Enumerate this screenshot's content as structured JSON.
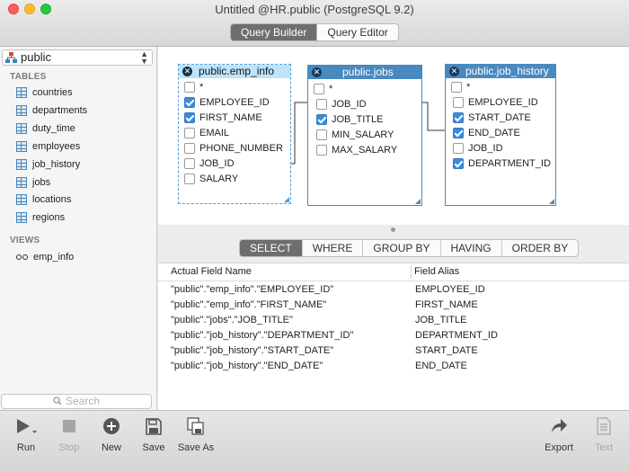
{
  "window": {
    "title": "Untitled @HR.public (PostgreSQL 9.2)",
    "modes": [
      "Query Builder",
      "Query Editor"
    ],
    "active_mode": "Query Builder"
  },
  "sidebar": {
    "schema": "public",
    "tables_header": "TABLES",
    "tables": [
      "countries",
      "departments",
      "duty_time",
      "employees",
      "job_history",
      "jobs",
      "locations",
      "regions"
    ],
    "views_header": "VIEWS",
    "views": [
      "emp_info"
    ],
    "search_placeholder": "Search"
  },
  "diagram": {
    "tables": [
      {
        "name": "public.emp_info",
        "selected": true,
        "all_checked": false,
        "fields": [
          [
            "EMPLOYEE_ID",
            true
          ],
          [
            "FIRST_NAME",
            true
          ],
          [
            "EMAIL",
            false
          ],
          [
            "PHONE_NUMBER",
            false
          ],
          [
            "JOB_ID",
            false
          ],
          [
            "SALARY",
            false
          ]
        ]
      },
      {
        "name": "public.jobs",
        "selected": false,
        "all_checked": false,
        "fields": [
          [
            "JOB_ID",
            false
          ],
          [
            "JOB_TITLE",
            true
          ],
          [
            "MIN_SALARY",
            false
          ],
          [
            "MAX_SALARY",
            false
          ]
        ]
      },
      {
        "name": "public.job_history",
        "selected": false,
        "all_checked": false,
        "fields": [
          [
            "EMPLOYEE_ID",
            false
          ],
          [
            "START_DATE",
            true
          ],
          [
            "END_DATE",
            true
          ],
          [
            "JOB_ID",
            false
          ],
          [
            "DEPARTMENT_ID",
            true
          ]
        ]
      }
    ],
    "all_label": "*"
  },
  "clause_tabs": [
    "SELECT",
    "WHERE",
    "GROUP BY",
    "HAVING",
    "ORDER BY"
  ],
  "active_clause": "SELECT",
  "fields_grid": {
    "columns": [
      "Actual Field Name",
      "Field Alias"
    ],
    "rows": [
      [
        "\"public\".\"emp_info\".\"EMPLOYEE_ID\"",
        "EMPLOYEE_ID"
      ],
      [
        "\"public\".\"emp_info\".\"FIRST_NAME\"",
        "FIRST_NAME"
      ],
      [
        "\"public\".\"jobs\".\"JOB_TITLE\"",
        "JOB_TITLE"
      ],
      [
        "\"public\".\"job_history\".\"DEPARTMENT_ID\"",
        "DEPARTMENT_ID"
      ],
      [
        "\"public\".\"job_history\".\"START_DATE\"",
        "START_DATE"
      ],
      [
        "\"public\".\"job_history\".\"END_DATE\"",
        "END_DATE"
      ]
    ]
  },
  "toolbar": {
    "run": "Run",
    "stop": "Stop",
    "new": "New",
    "save": "Save",
    "save_as": "Save As",
    "export": "Export",
    "text": "Text"
  },
  "colors": {
    "accent": "#4a88c0",
    "selected_header": "#bfe3fb",
    "checkbox": "#3b8bdf"
  }
}
